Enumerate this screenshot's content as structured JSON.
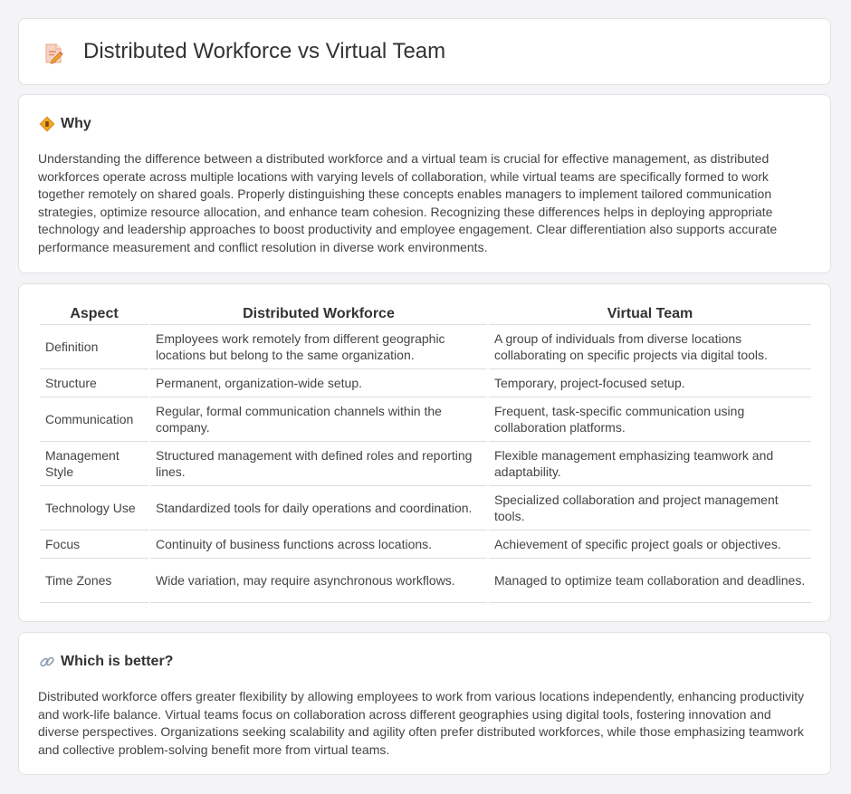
{
  "header": {
    "title": "Distributed Workforce vs Virtual Team",
    "icon": "document-pencil-icon"
  },
  "why": {
    "icon": "diamond-sign-icon",
    "title": "Why",
    "text": "Understanding the difference between a distributed workforce and a virtual team is crucial for effective management, as distributed workforces operate across multiple locations with varying levels of collaboration, while virtual teams are specifically formed to work together remotely on shared goals. Properly distinguishing these concepts enables managers to implement tailored communication strategies, optimize resource allocation, and enhance team cohesion. Recognizing these differences helps in deploying appropriate technology and leadership approaches to boost productivity and employee engagement. Clear differentiation also supports accurate performance measurement and conflict resolution in diverse work environments."
  },
  "comparison": {
    "headers": [
      "Aspect",
      "Distributed Workforce",
      "Virtual Team"
    ],
    "rows": [
      {
        "aspect": "Definition",
        "distributed": "Employees work remotely from different geographic locations but belong to the same organization.",
        "virtual": "A group of individuals from diverse locations collaborating on specific projects via digital tools."
      },
      {
        "aspect": "Structure",
        "distributed": "Permanent, organization-wide setup.",
        "virtual": "Temporary, project-focused setup."
      },
      {
        "aspect": "Communication",
        "distributed": "Regular, formal communication channels within the company.",
        "virtual": "Frequent, task-specific communication using collaboration platforms."
      },
      {
        "aspect": "Management Style",
        "distributed": "Structured management with defined roles and reporting lines.",
        "virtual": "Flexible management emphasizing teamwork and adaptability."
      },
      {
        "aspect": "Technology Use",
        "distributed": "Standardized tools for daily operations and coordination.",
        "virtual": "Specialized collaboration and project management tools."
      },
      {
        "aspect": "Focus",
        "distributed": "Continuity of business functions across locations.",
        "virtual": "Achievement of specific project goals or objectives."
      },
      {
        "aspect": "Time Zones",
        "distributed": "Wide variation, may require asynchronous workflows.",
        "virtual": "Managed to optimize team collaboration and deadlines."
      }
    ]
  },
  "better": {
    "icon": "link-icon",
    "title": "Which is better?",
    "text": "Distributed workforce offers greater flexibility by allowing employees to work from various locations independently, enhancing productivity and work-life balance. Virtual teams focus on collaboration across different geographies using digital tools, fostering innovation and diverse perspectives. Organizations seeking scalability and agility often prefer distributed workforces, while those emphasizing teamwork and collective problem-solving benefit more from virtual teams."
  }
}
